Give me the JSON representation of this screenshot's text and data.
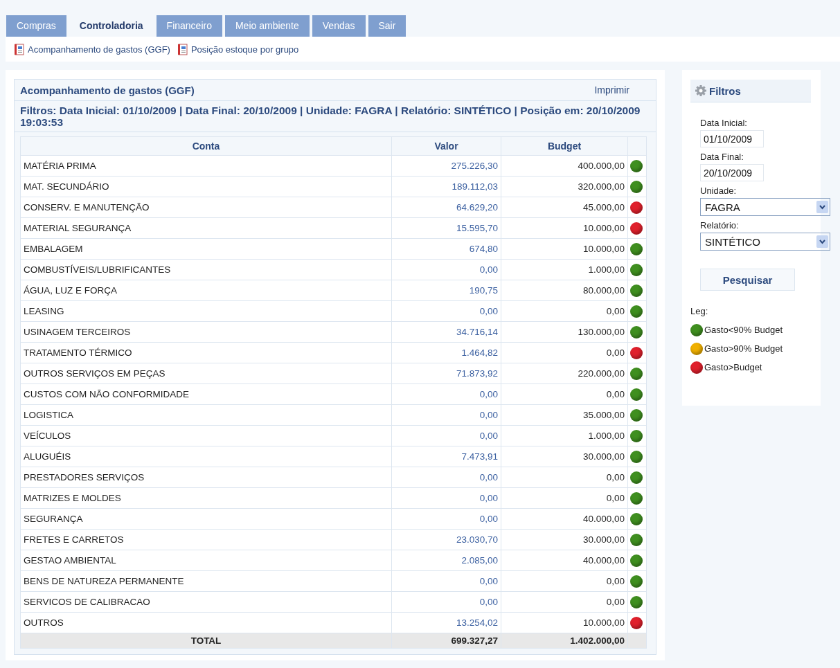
{
  "tabs": [
    {
      "label": "Compras",
      "selected": false
    },
    {
      "label": "Controladoria",
      "selected": true
    },
    {
      "label": "Financeiro",
      "selected": false
    },
    {
      "label": "Meio ambiente",
      "selected": false
    },
    {
      "label": "Vendas",
      "selected": false
    },
    {
      "label": "Sair",
      "selected": false
    }
  ],
  "subnav": [
    "Acompanhamento de gastos (GGF)",
    "Posição estoque por grupo"
  ],
  "report": {
    "title": "Acompanhamento de gastos (GGF)",
    "print": "Imprimir",
    "filters": "Filtros: Data Inicial: 01/10/2009 | Data Final: 20/10/2009 | Unidade: FAGRA | Relatório: SINTÉTICO | Posição em: 20/10/2009 19:03:53",
    "columns": [
      "Conta",
      "Valor",
      "Budget"
    ],
    "rows": [
      {
        "conta": "MATÉRIA PRIMA",
        "valor": "275.226,30",
        "budget": "400.000,00",
        "color": "#3f8f1f"
      },
      {
        "conta": "MAT. SECUNDÁRIO",
        "valor": "189.112,03",
        "budget": "320.000,00",
        "color": "#3f8f1f"
      },
      {
        "conta": "CONSERV. E MANUTENÇÃO",
        "valor": "64.629,20",
        "budget": "45.000,00",
        "color": "#e0202c"
      },
      {
        "conta": "MATERIAL SEGURANÇA",
        "valor": "15.595,70",
        "budget": "10.000,00",
        "color": "#e0202c"
      },
      {
        "conta": "EMBALAGEM",
        "valor": "674,80",
        "budget": "10.000,00",
        "color": "#3f8f1f"
      },
      {
        "conta": "COMBUSTÍVEIS/LUBRIFICANTES",
        "valor": "0,00",
        "budget": "1.000,00",
        "color": "#3f8f1f"
      },
      {
        "conta": "ÁGUA, LUZ E FORÇA",
        "valor": "190,75",
        "budget": "80.000,00",
        "color": "#3f8f1f"
      },
      {
        "conta": "LEASING",
        "valor": "0,00",
        "budget": "0,00",
        "color": "#3f8f1f"
      },
      {
        "conta": "USINAGEM TERCEIROS",
        "valor": "34.716,14",
        "budget": "130.000,00",
        "color": "#3f8f1f"
      },
      {
        "conta": "TRATAMENTO TÉRMICO",
        "valor": "1.464,82",
        "budget": "0,00",
        "color": "#e0202c"
      },
      {
        "conta": "OUTROS SERVIÇOS EM PEÇAS",
        "valor": "71.873,92",
        "budget": "220.000,00",
        "color": "#3f8f1f"
      },
      {
        "conta": "CUSTOS COM NÃO CONFORMIDADE",
        "valor": "0,00",
        "budget": "0,00",
        "color": "#3f8f1f"
      },
      {
        "conta": "LOGISTICA",
        "valor": "0,00",
        "budget": "35.000,00",
        "color": "#3f8f1f"
      },
      {
        "conta": "VEÍCULOS",
        "valor": "0,00",
        "budget": "1.000,00",
        "color": "#3f8f1f"
      },
      {
        "conta": "ALUGUÉIS",
        "valor": "7.473,91",
        "budget": "30.000,00",
        "color": "#3f8f1f"
      },
      {
        "conta": "PRESTADORES SERVIÇOS",
        "valor": "0,00",
        "budget": "0,00",
        "color": "#3f8f1f"
      },
      {
        "conta": "MATRIZES E MOLDES",
        "valor": "0,00",
        "budget": "0,00",
        "color": "#3f8f1f"
      },
      {
        "conta": "SEGURANÇA",
        "valor": "0,00",
        "budget": "40.000,00",
        "color": "#3f8f1f"
      },
      {
        "conta": "FRETES E CARRETOS",
        "valor": "23.030,70",
        "budget": "30.000,00",
        "color": "#3f8f1f"
      },
      {
        "conta": "GESTAO AMBIENTAL",
        "valor": "2.085,00",
        "budget": "40.000,00",
        "color": "#3f8f1f"
      },
      {
        "conta": "BENS DE NATUREZA PERMANENTE",
        "valor": "0,00",
        "budget": "0,00",
        "color": "#3f8f1f"
      },
      {
        "conta": "SERVICOS DE CALIBRACAO",
        "valor": "0,00",
        "budget": "0,00",
        "color": "#3f8f1f"
      },
      {
        "conta": "OUTROS",
        "valor": "13.254,02",
        "budget": "10.000,00",
        "color": "#e0202c"
      }
    ],
    "total": {
      "label": "TOTAL",
      "valor": "699.327,27",
      "budget": "1.402.000,00"
    }
  },
  "sidebar": {
    "title": "Filtros",
    "fields": [
      {
        "kind": "text",
        "label": "Data Inicial:",
        "value": "01/10/2009"
      },
      {
        "kind": "text",
        "label": "Data Final:",
        "value": "20/10/2009"
      },
      {
        "kind": "select",
        "label": "Unidade:",
        "value": "FAGRA"
      },
      {
        "kind": "select",
        "label": "Relatório:",
        "value": "SINTÉTICO"
      }
    ],
    "button": "Pesquisar",
    "legend_title": "Leg:",
    "legend": [
      {
        "label": "Gasto<90% Budget",
        "color": "#3f8f1f"
      },
      {
        "label": "Gasto>90% Budget",
        "color": "#f0b000"
      },
      {
        "label": "Gasto>Budget",
        "color": "#e0202c"
      }
    ]
  }
}
